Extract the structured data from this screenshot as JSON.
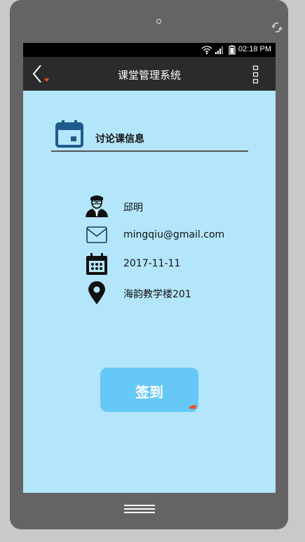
{
  "statusbar": {
    "time": "02:18 PM"
  },
  "appbar": {
    "title": "课堂管理系统",
    "back_icon": "back-arrow-icon",
    "menu_icon": "overflow-menu-icon"
  },
  "section": {
    "title": "讨论课信息",
    "icon": "calendar-icon"
  },
  "info": {
    "name": "邱明",
    "email": "mingqiu@gmail.com",
    "date": "2017-11-11",
    "location": "海韵教学楼201"
  },
  "actions": {
    "checkin_label": "签到"
  },
  "colors": {
    "screen_bg": "#b4e6fb",
    "appbar_bg": "#2b2b2b",
    "button_bg": "#66c8f6",
    "accent_icon": "#1f5b8a",
    "device_frame": "#646464"
  }
}
